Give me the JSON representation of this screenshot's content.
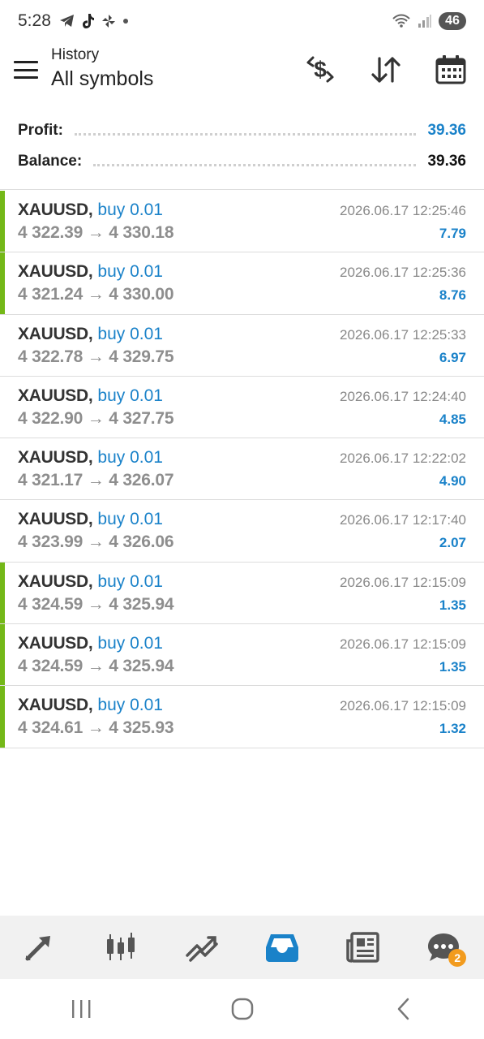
{
  "status_bar": {
    "time": "5:28",
    "battery": "46"
  },
  "header": {
    "subtitle": "History",
    "title": "All symbols"
  },
  "summary": {
    "profit_label": "Profit:",
    "profit_value": "39.36",
    "balance_label": "Balance:",
    "balance_value": "39.36"
  },
  "deals": [
    {
      "symbol": "XAUUSD,",
      "side": "buy 0.01",
      "time": "2026.06.17 12:25:46",
      "prices": "4 322.39 → 4 330.18",
      "profit": "7.79",
      "marked": true
    },
    {
      "symbol": "XAUUSD,",
      "side": "buy 0.01",
      "time": "2026.06.17 12:25:36",
      "prices": "4 321.24 → 4 330.00",
      "profit": "8.76",
      "marked": true
    },
    {
      "symbol": "XAUUSD,",
      "side": "buy 0.01",
      "time": "2026.06.17 12:25:33",
      "prices": "4 322.78 → 4 329.75",
      "profit": "6.97",
      "marked": false
    },
    {
      "symbol": "XAUUSD,",
      "side": "buy 0.01",
      "time": "2026.06.17 12:24:40",
      "prices": "4 322.90 → 4 327.75",
      "profit": "4.85",
      "marked": false
    },
    {
      "symbol": "XAUUSD,",
      "side": "buy 0.01",
      "time": "2026.06.17 12:22:02",
      "prices": "4 321.17 → 4 326.07",
      "profit": "4.90",
      "marked": false
    },
    {
      "symbol": "XAUUSD,",
      "side": "buy 0.01",
      "time": "2026.06.17 12:17:40",
      "prices": "4 323.99 → 4 326.06",
      "profit": "2.07",
      "marked": false
    },
    {
      "symbol": "XAUUSD,",
      "side": "buy 0.01",
      "time": "2026.06.17 12:15:09",
      "prices": "4 324.59 → 4 325.94",
      "profit": "1.35",
      "marked": true
    },
    {
      "symbol": "XAUUSD,",
      "side": "buy 0.01",
      "time": "2026.06.17 12:15:09",
      "prices": "4 324.59 → 4 325.94",
      "profit": "1.35",
      "marked": true
    },
    {
      "symbol": "XAUUSD,",
      "side": "buy 0.01",
      "time": "2026.06.17 12:15:09",
      "prices": "4 324.61 → 4 325.93",
      "profit": "1.32",
      "marked": true
    }
  ],
  "bottom_nav": {
    "chat_badge": "2"
  },
  "icons": {
    "menu": "hamburger-menu-icon",
    "deposit": "currency-exchange-icon",
    "sort": "sort-arrows-icon",
    "calendar": "calendar-icon",
    "quotes": "trade-arrows-icon",
    "chart": "candlestick-icon",
    "trade": "trend-lines-icon",
    "history": "inbox-tray-icon",
    "news": "newspaper-icon",
    "chat": "chat-bubble-icon"
  },
  "colors": {
    "accent": "#1a82c9",
    "marker": "#74b818",
    "badge": "#f29b1e"
  }
}
